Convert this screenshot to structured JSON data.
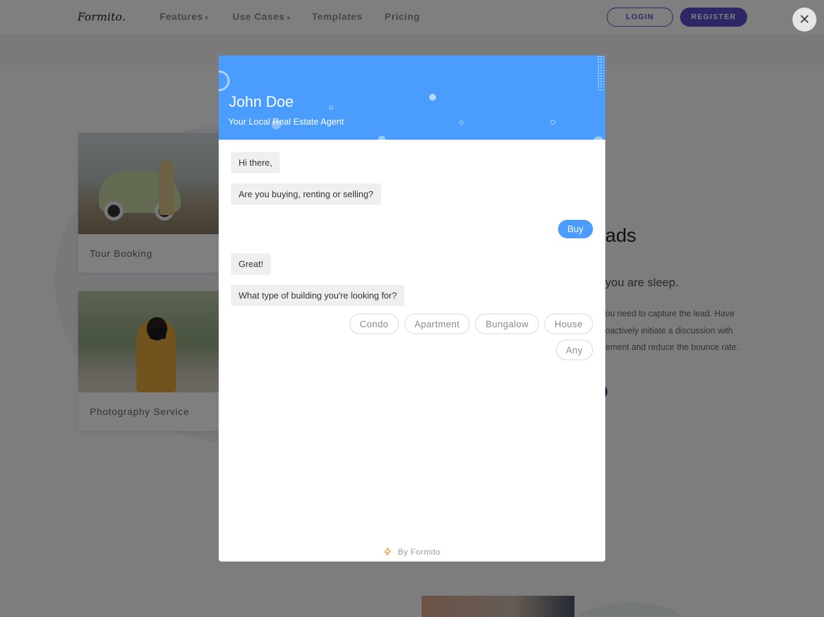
{
  "nav": {
    "logo": "Formito.",
    "links": [
      {
        "label": "Features",
        "dropdown": true
      },
      {
        "label": "Use Cases",
        "dropdown": true
      },
      {
        "label": "Templates",
        "dropdown": false
      },
      {
        "label": "Pricing",
        "dropdown": false
      }
    ],
    "login": "LOGIN",
    "register": "REGISTER",
    "caret": "⌄"
  },
  "background": {
    "cards": [
      {
        "label": "Tour Booking"
      },
      {
        "label": "Photography Service"
      }
    ],
    "heading_fragment": "ads",
    "sub_fragment": "you are sleep.",
    "para_lines": [
      "ou need to capture the lead. Have",
      "oactively initiate a discussion with",
      "ement and reduce the bounce rate."
    ]
  },
  "modal": {
    "close_glyph": "✕",
    "agent_name": "John Doe",
    "agent_title": "Your Local Real Estate Agent",
    "messages": {
      "greeting": "Hi there,",
      "question1": "Are you buying, renting or selling?",
      "user_reply": "Buy",
      "ack": "Great!",
      "question2": "What type of building you're looking for?"
    },
    "options": [
      "Condo",
      "Apartment",
      "Bungalow",
      "House",
      "Any"
    ],
    "footer": "By Formito",
    "footer_icon": "lightning-icon"
  },
  "colors": {
    "accent": "#4b9dfd",
    "brand": "#5b4fcf",
    "overlay": "rgba(0,0,0,0.5)"
  }
}
